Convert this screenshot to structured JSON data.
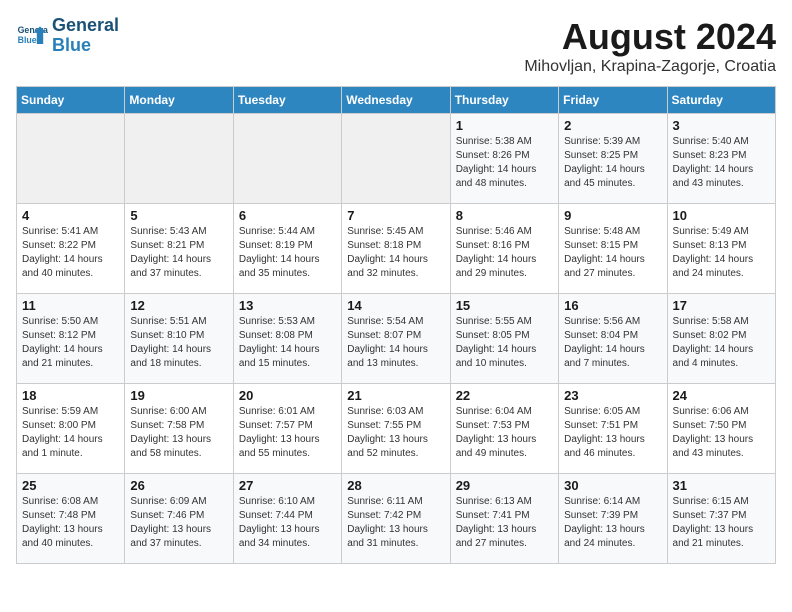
{
  "header": {
    "logo_line1": "General",
    "logo_line2": "Blue",
    "month": "August 2024",
    "location": "Mihovljan, Krapina-Zagorje, Croatia"
  },
  "days_of_week": [
    "Sunday",
    "Monday",
    "Tuesday",
    "Wednesday",
    "Thursday",
    "Friday",
    "Saturday"
  ],
  "weeks": [
    [
      {
        "day": "",
        "info": ""
      },
      {
        "day": "",
        "info": ""
      },
      {
        "day": "",
        "info": ""
      },
      {
        "day": "",
        "info": ""
      },
      {
        "day": "1",
        "info": "Sunrise: 5:38 AM\nSunset: 8:26 PM\nDaylight: 14 hours and 48 minutes."
      },
      {
        "day": "2",
        "info": "Sunrise: 5:39 AM\nSunset: 8:25 PM\nDaylight: 14 hours and 45 minutes."
      },
      {
        "day": "3",
        "info": "Sunrise: 5:40 AM\nSunset: 8:23 PM\nDaylight: 14 hours and 43 minutes."
      }
    ],
    [
      {
        "day": "4",
        "info": "Sunrise: 5:41 AM\nSunset: 8:22 PM\nDaylight: 14 hours and 40 minutes."
      },
      {
        "day": "5",
        "info": "Sunrise: 5:43 AM\nSunset: 8:21 PM\nDaylight: 14 hours and 37 minutes."
      },
      {
        "day": "6",
        "info": "Sunrise: 5:44 AM\nSunset: 8:19 PM\nDaylight: 14 hours and 35 minutes."
      },
      {
        "day": "7",
        "info": "Sunrise: 5:45 AM\nSunset: 8:18 PM\nDaylight: 14 hours and 32 minutes."
      },
      {
        "day": "8",
        "info": "Sunrise: 5:46 AM\nSunset: 8:16 PM\nDaylight: 14 hours and 29 minutes."
      },
      {
        "day": "9",
        "info": "Sunrise: 5:48 AM\nSunset: 8:15 PM\nDaylight: 14 hours and 27 minutes."
      },
      {
        "day": "10",
        "info": "Sunrise: 5:49 AM\nSunset: 8:13 PM\nDaylight: 14 hours and 24 minutes."
      }
    ],
    [
      {
        "day": "11",
        "info": "Sunrise: 5:50 AM\nSunset: 8:12 PM\nDaylight: 14 hours and 21 minutes."
      },
      {
        "day": "12",
        "info": "Sunrise: 5:51 AM\nSunset: 8:10 PM\nDaylight: 14 hours and 18 minutes."
      },
      {
        "day": "13",
        "info": "Sunrise: 5:53 AM\nSunset: 8:08 PM\nDaylight: 14 hours and 15 minutes."
      },
      {
        "day": "14",
        "info": "Sunrise: 5:54 AM\nSunset: 8:07 PM\nDaylight: 14 hours and 13 minutes."
      },
      {
        "day": "15",
        "info": "Sunrise: 5:55 AM\nSunset: 8:05 PM\nDaylight: 14 hours and 10 minutes."
      },
      {
        "day": "16",
        "info": "Sunrise: 5:56 AM\nSunset: 8:04 PM\nDaylight: 14 hours and 7 minutes."
      },
      {
        "day": "17",
        "info": "Sunrise: 5:58 AM\nSunset: 8:02 PM\nDaylight: 14 hours and 4 minutes."
      }
    ],
    [
      {
        "day": "18",
        "info": "Sunrise: 5:59 AM\nSunset: 8:00 PM\nDaylight: 14 hours and 1 minute."
      },
      {
        "day": "19",
        "info": "Sunrise: 6:00 AM\nSunset: 7:58 PM\nDaylight: 13 hours and 58 minutes."
      },
      {
        "day": "20",
        "info": "Sunrise: 6:01 AM\nSunset: 7:57 PM\nDaylight: 13 hours and 55 minutes."
      },
      {
        "day": "21",
        "info": "Sunrise: 6:03 AM\nSunset: 7:55 PM\nDaylight: 13 hours and 52 minutes."
      },
      {
        "day": "22",
        "info": "Sunrise: 6:04 AM\nSunset: 7:53 PM\nDaylight: 13 hours and 49 minutes."
      },
      {
        "day": "23",
        "info": "Sunrise: 6:05 AM\nSunset: 7:51 PM\nDaylight: 13 hours and 46 minutes."
      },
      {
        "day": "24",
        "info": "Sunrise: 6:06 AM\nSunset: 7:50 PM\nDaylight: 13 hours and 43 minutes."
      }
    ],
    [
      {
        "day": "25",
        "info": "Sunrise: 6:08 AM\nSunset: 7:48 PM\nDaylight: 13 hours and 40 minutes."
      },
      {
        "day": "26",
        "info": "Sunrise: 6:09 AM\nSunset: 7:46 PM\nDaylight: 13 hours and 37 minutes."
      },
      {
        "day": "27",
        "info": "Sunrise: 6:10 AM\nSunset: 7:44 PM\nDaylight: 13 hours and 34 minutes."
      },
      {
        "day": "28",
        "info": "Sunrise: 6:11 AM\nSunset: 7:42 PM\nDaylight: 13 hours and 31 minutes."
      },
      {
        "day": "29",
        "info": "Sunrise: 6:13 AM\nSunset: 7:41 PM\nDaylight: 13 hours and 27 minutes."
      },
      {
        "day": "30",
        "info": "Sunrise: 6:14 AM\nSunset: 7:39 PM\nDaylight: 13 hours and 24 minutes."
      },
      {
        "day": "31",
        "info": "Sunrise: 6:15 AM\nSunset: 7:37 PM\nDaylight: 13 hours and 21 minutes."
      }
    ]
  ]
}
